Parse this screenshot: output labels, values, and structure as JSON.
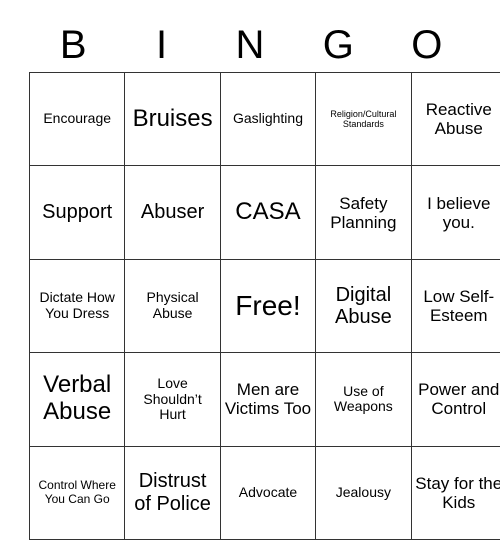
{
  "card": {
    "header_letters": [
      "B",
      "I",
      "N",
      "G",
      "O"
    ],
    "rows": [
      [
        {
          "text": "Encourage",
          "size": "sz-md"
        },
        {
          "text": "Bruises",
          "size": "sz-xxl"
        },
        {
          "text": "Gaslighting",
          "size": "sz-md"
        },
        {
          "text": "Religion/Cultural Standards",
          "size": "sz-xs"
        },
        {
          "text": "Reactive Abuse",
          "size": "sz-lg"
        }
      ],
      [
        {
          "text": "Support",
          "size": "sz-xl"
        },
        {
          "text": "Abuser",
          "size": "sz-xl"
        },
        {
          "text": "CASA",
          "size": "sz-xxl"
        },
        {
          "text": "Safety Planning",
          "size": "sz-lg"
        },
        {
          "text": "I believe you.",
          "size": "sz-lg"
        }
      ],
      [
        {
          "text": "Dictate How You Dress",
          "size": "sz-md"
        },
        {
          "text": "Physical Abuse",
          "size": "sz-md"
        },
        {
          "text": "Free!",
          "size": "sz-free"
        },
        {
          "text": "Digital Abuse",
          "size": "sz-xl"
        },
        {
          "text": "Low Self-Esteem",
          "size": "sz-lg"
        }
      ],
      [
        {
          "text": "Verbal Abuse",
          "size": "sz-xxl"
        },
        {
          "text": "Love Shouldn’t Hurt",
          "size": "sz-md"
        },
        {
          "text": "Men are Victims Too",
          "size": "sz-lg"
        },
        {
          "text": "Use of Weapons",
          "size": "sz-md"
        },
        {
          "text": "Power and Control",
          "size": "sz-lg"
        }
      ],
      [
        {
          "text": "Control Where You Can Go",
          "size": "sz-sm"
        },
        {
          "text": "Distrust of Police",
          "size": "sz-xl"
        },
        {
          "text": "Advocate",
          "size": "sz-md"
        },
        {
          "text": "Jealousy",
          "size": "sz-md"
        },
        {
          "text": "Stay for the Kids",
          "size": "sz-lg"
        }
      ]
    ]
  },
  "colors": {
    "background": "#ffffff",
    "text": "#000000",
    "border": "#333333"
  }
}
